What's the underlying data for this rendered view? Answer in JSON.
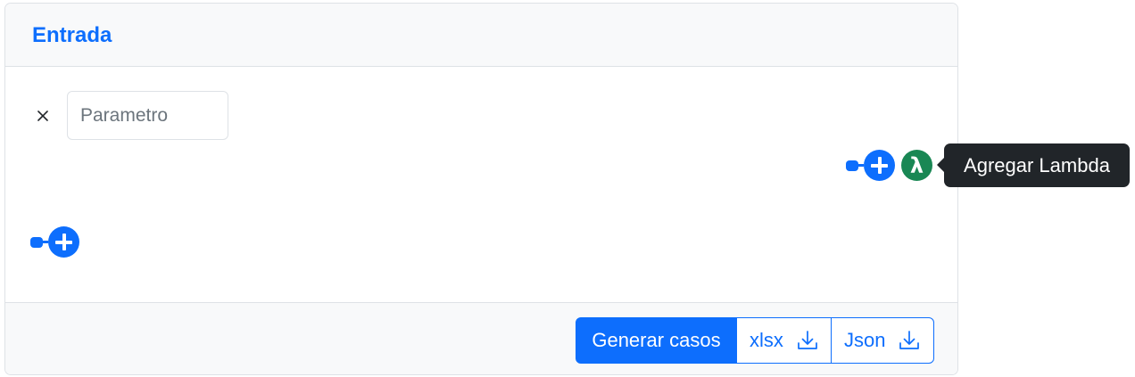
{
  "card": {
    "title": "Entrada"
  },
  "parameter": {
    "placeholder": "Parametro",
    "value": ""
  },
  "icons": {
    "remove": "close-icon",
    "add": "plus-circle-icon",
    "lambda": "lambda-icon",
    "download": "download-icon"
  },
  "lambda": {
    "symbol": "λ",
    "tooltip": "Agregar Lambda"
  },
  "footer": {
    "generate_label": "Generar casos",
    "xlsx_label": "xlsx",
    "json_label": "Json"
  },
  "colors": {
    "primary": "#0d6efd",
    "success": "#198754",
    "tooltip_bg": "#212529",
    "header_bg": "#f8f9fa",
    "border": "#dee2e6"
  }
}
